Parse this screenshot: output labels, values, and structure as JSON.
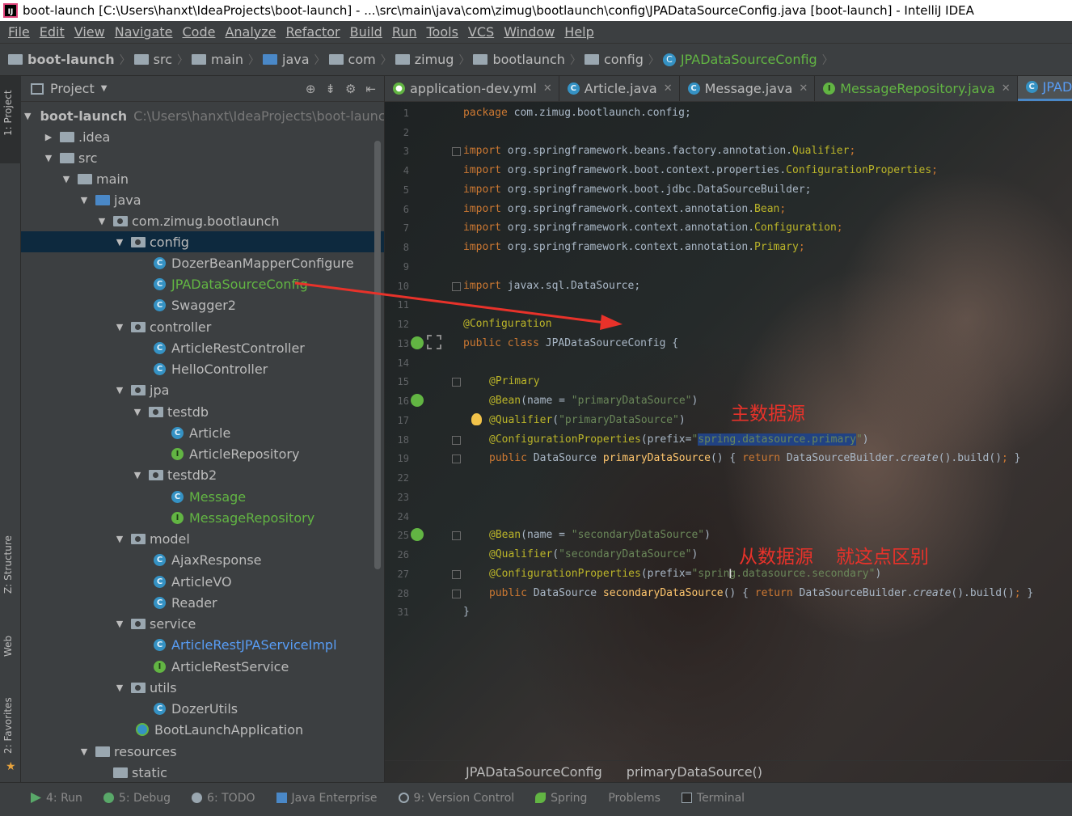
{
  "window": {
    "title": "boot-launch [C:\\Users\\hanxt\\IdeaProjects\\boot-launch] - ...\\src\\main\\java\\com\\zimug\\bootlaunch\\config\\JPADataSourceConfig.java [boot-launch] - IntelliJ IDEA"
  },
  "menu": [
    "File",
    "Edit",
    "View",
    "Navigate",
    "Code",
    "Analyze",
    "Refactor",
    "Build",
    "Run",
    "Tools",
    "VCS",
    "Window",
    "Help"
  ],
  "breadcrumb": [
    "boot-launch",
    "src",
    "main",
    "java",
    "com",
    "zimug",
    "bootlaunch",
    "config",
    "JPADataSourceConfig"
  ],
  "strip": {
    "project": "1: Project",
    "structure": "Z: Structure",
    "web": "Web",
    "favorites": "2: Favorites"
  },
  "project_panel": {
    "title": "Project",
    "root_path": "C:\\Users\\hanxt\\IdeaProjects\\boot-launch",
    "tree": [
      {
        "label": "boot-launch"
      },
      {
        "label": ".idea"
      },
      {
        "label": "src"
      },
      {
        "label": "main"
      },
      {
        "label": "java"
      },
      {
        "label": "com.zimug.bootlaunch"
      },
      {
        "label": "config"
      },
      {
        "label": "DozerBeanMapperConfigure"
      },
      {
        "label": "JPADataSourceConfig"
      },
      {
        "label": "Swagger2"
      },
      {
        "label": "controller"
      },
      {
        "label": "ArticleRestController"
      },
      {
        "label": "HelloController"
      },
      {
        "label": "jpa"
      },
      {
        "label": "testdb"
      },
      {
        "label": "Article"
      },
      {
        "label": "ArticleRepository"
      },
      {
        "label": "testdb2"
      },
      {
        "label": "Message"
      },
      {
        "label": "MessageRepository"
      },
      {
        "label": "model"
      },
      {
        "label": "AjaxResponse"
      },
      {
        "label": "ArticleVO"
      },
      {
        "label": "Reader"
      },
      {
        "label": "service"
      },
      {
        "label": "ArticleRestJPAServiceImpl"
      },
      {
        "label": "ArticleRestService"
      },
      {
        "label": "utils"
      },
      {
        "label": "DozerUtils"
      },
      {
        "label": "BootLaunchApplication"
      },
      {
        "label": "resources"
      },
      {
        "label": "static"
      }
    ]
  },
  "tabs": [
    {
      "label": "application-dev.yml"
    },
    {
      "label": "Article.java"
    },
    {
      "label": "Message.java"
    },
    {
      "label": "MessageRepository.java"
    },
    {
      "label": "JPADataS"
    }
  ],
  "line_numbers": [
    "1",
    "2",
    "3",
    "4",
    "5",
    "6",
    "7",
    "8",
    "9",
    "10",
    "11",
    "12",
    "13",
    "14",
    "15",
    "16",
    "17",
    "18",
    "19",
    "22",
    "23",
    "24",
    "25",
    "26",
    "27",
    "28",
    "31"
  ],
  "code": {
    "l1_kw": "package",
    "l1_rest": " com.zimug.bootlaunch.config;",
    "import_kw": "import",
    "l3": " org.springframework.beans.factory.annotation.",
    "l3_a": "Qualifier",
    "l3_e": ";",
    "l4": " org.springframework.boot.context.properties.",
    "l4_a": "ConfigurationProperties",
    "l4_e": ";",
    "l5": " org.springframework.boot.jdbc.DataSourceBuilder;",
    "l6": " org.springframework.context.annotation.",
    "l6_a": "Bean",
    "l6_e": ";",
    "l7": " org.springframework.context.annotation.",
    "l7_a": "Configuration",
    "l7_e": ";",
    "l8": " org.springframework.context.annotation.",
    "l8_a": "Primary",
    "l8_e": ";",
    "l10": " javax.sql.DataSource;",
    "l12": "@Configuration",
    "l13_kw": "public class",
    "l13_rest": " JPADataSourceConfig {",
    "l15": "@Primary",
    "l16_a": "@Bean",
    "l16_b": "(name = ",
    "l16_s": "\"primaryDataSource\"",
    "l16_e": ")",
    "l17_a": "@Qualifier",
    "l17_b": "(",
    "l17_s": "\"primaryDataSource\"",
    "l17_e": ")",
    "l18_a": "@ConfigurationProperties",
    "l18_b": "(prefix=",
    "l18_s1": "\"",
    "l18_hl": "spring.datasource.primary",
    "l18_s2": "\"",
    "l18_e": ")",
    "l19_kw": "public",
    "l19_t": " DataSource ",
    "l19_fn": "primaryDataSource",
    "l19_p": "() { ",
    "l19_r": "return",
    "l19_b": " DataSourceBuilder.",
    "l19_c": "create",
    "l19_d": "().build()",
    "l19_semi": ";",
    "l19_end": " }",
    "l25_a": "@Bean",
    "l25_b": "(name = ",
    "l25_s": "\"secondaryDataSource\"",
    "l25_e": ")",
    "l26_a": "@Qualifier",
    "l26_b": "(",
    "l26_s": "\"secondaryDataSource\"",
    "l26_e": ")",
    "l27_a": "@ConfigurationProperties",
    "l27_b": "(prefix=",
    "l27_s": "\"spring.datasource.secondary\"",
    "l27_e": ")",
    "l28_kw": "public",
    "l28_t": " DataSource ",
    "l28_fn": "secondaryDataSource",
    "l28_p": "() { ",
    "l28_r": "return",
    "l28_b": " DataSourceBuilder.",
    "l28_c": "create",
    "l28_d": "().build()",
    "l28_semi": ";",
    "l28_end": " }",
    "l31": "}"
  },
  "annotations": {
    "primary": "主数据源",
    "secondary": "从数据源",
    "difference": "就这点区别"
  },
  "editor_breadcrumb": [
    "JPADataSourceConfig",
    "primaryDataSource()"
  ],
  "bottom_tools": [
    {
      "label": "4: Run"
    },
    {
      "label": "5: Debug"
    },
    {
      "label": "6: TODO"
    },
    {
      "label": "Java Enterprise"
    },
    {
      "label": "9: Version Control"
    },
    {
      "label": "Spring"
    },
    {
      "label": "Problems"
    },
    {
      "label": "Terminal"
    }
  ],
  "colors": {
    "arrow": "#e8322a",
    "selection": "#0d293e",
    "keyword": "#cc7832",
    "annotation": "#bbb529",
    "string": "#6a8759"
  }
}
